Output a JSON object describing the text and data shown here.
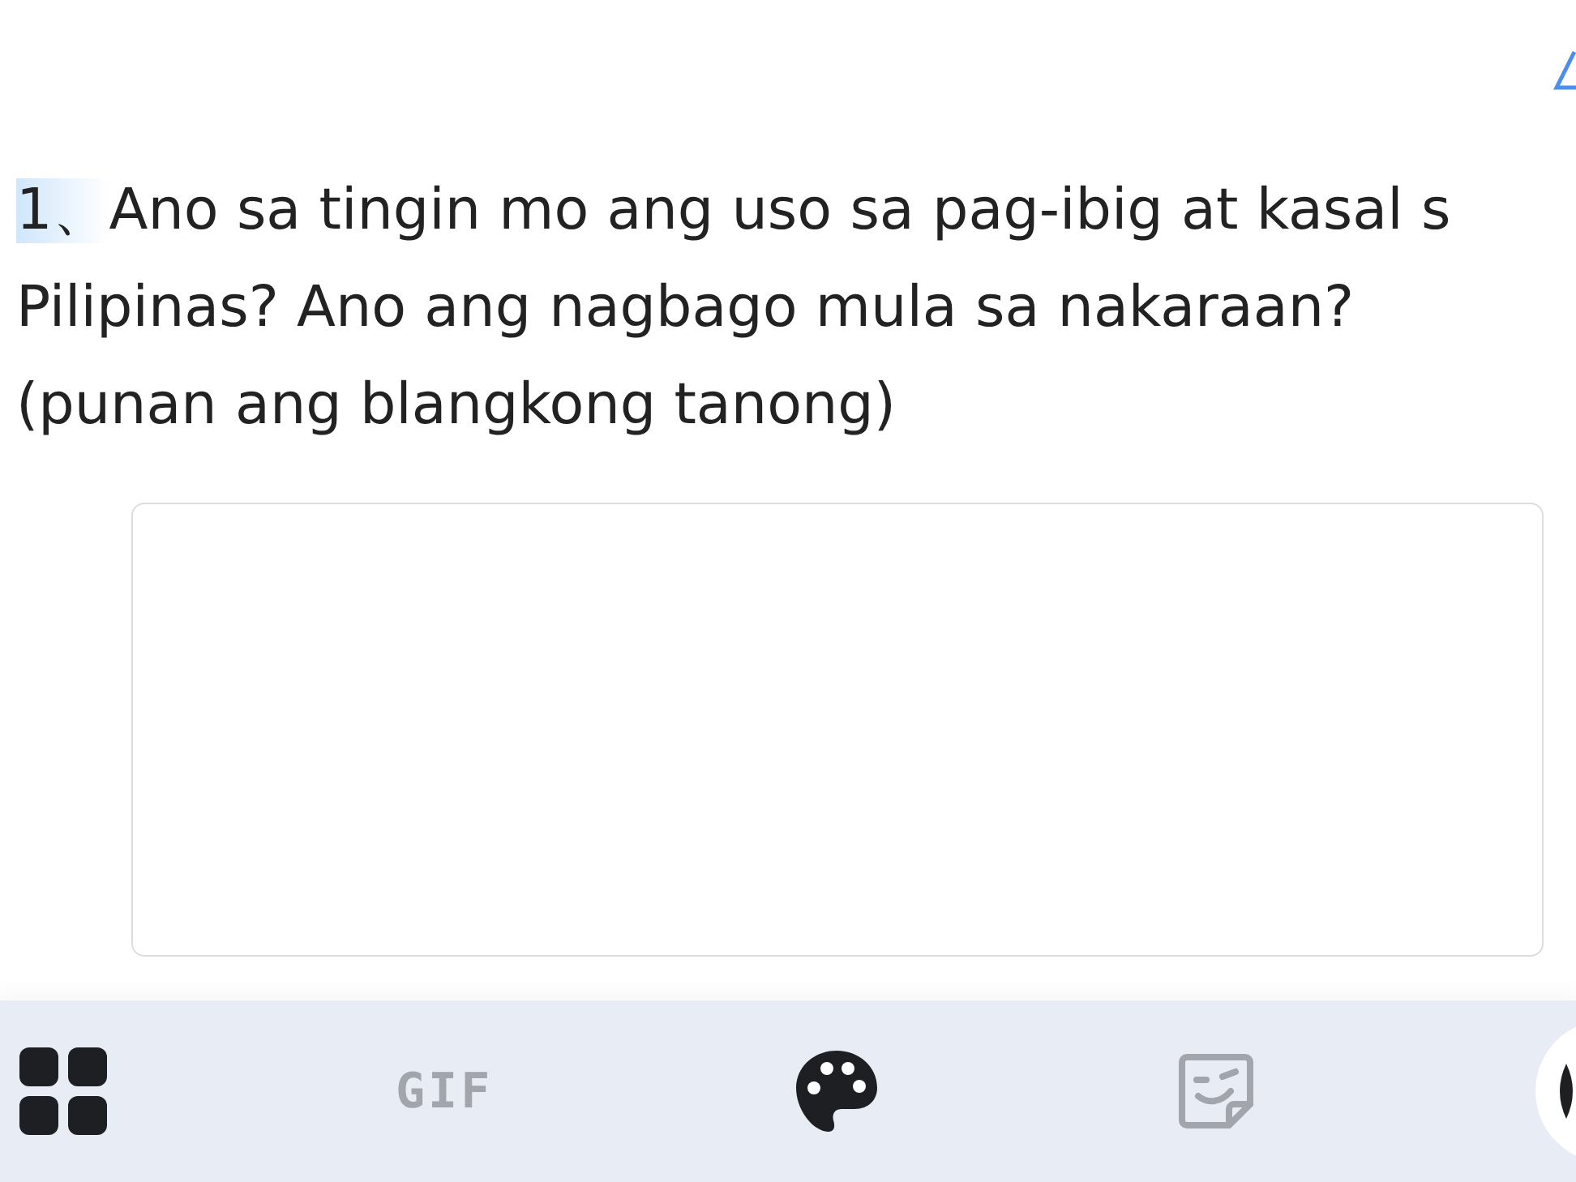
{
  "question": {
    "number": "1、",
    "lines": [
      "Ano sa tingin mo ang uso sa pag-ibig at kasal s",
      "Pilipinas? Ano ang nagbago mula sa nakaraan?",
      "(punan ang blangkong tanong)"
    ]
  },
  "toolbar": [
    {
      "kind": "grid",
      "disabled": false
    },
    {
      "kind": "gif",
      "label": "GIF",
      "disabled": true
    },
    {
      "kind": "palette",
      "disabled": false
    },
    {
      "kind": "sticker",
      "disabled": true
    },
    {
      "kind": "round"
    }
  ]
}
